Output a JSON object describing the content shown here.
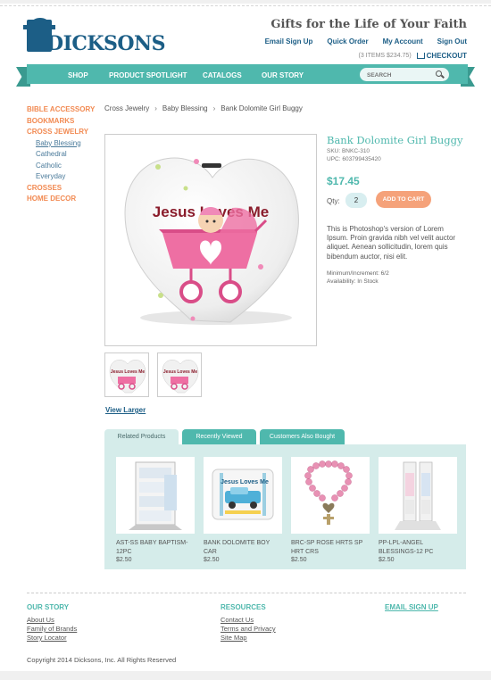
{
  "header": {
    "logo_text": "DICKSONS",
    "tagline": "Gifts for the Life of Your Faith",
    "links": [
      "Email Sign Up",
      "Quick Order",
      "My Account",
      "Sign Out"
    ],
    "cart_items": "(3 ITEMS $234.75)",
    "checkout_label": "CHECKOUT"
  },
  "nav": {
    "items": [
      "SHOP",
      "PRODUCT SPOTLIGHT",
      "CATALOGS",
      "OUR STORY"
    ],
    "search_placeholder": "SEARCH"
  },
  "sidebar": {
    "items": [
      {
        "label": "BIBLE ACCESSORY",
        "type": "category"
      },
      {
        "label": "BOOKMARKS",
        "type": "category"
      },
      {
        "label": "CROSS JEWELRY",
        "type": "category"
      },
      {
        "label": "Baby Blessing",
        "type": "sub",
        "active": true
      },
      {
        "label": "Cathedral",
        "type": "sub"
      },
      {
        "label": "Catholic",
        "type": "sub"
      },
      {
        "label": "Everyday",
        "type": "sub"
      },
      {
        "label": "CROSSES",
        "type": "category"
      },
      {
        "label": "HOME DECOR",
        "type": "category"
      }
    ]
  },
  "breadcrumb": [
    "Cross Jewelry",
    "Baby Blessing",
    "Bank Dolomite Girl Buggy"
  ],
  "product": {
    "title": "Bank Dolomite Girl Buggy",
    "sku": "SKU: BNKC-310",
    "upc": "UPC: 603799435420",
    "price": "$17.45",
    "qty_label": "Qty:",
    "qty_value": "2",
    "add_to_cart": "ADD TO CART",
    "description": "This is Photoshop's version  of Lorem Ipsum. Proin gravida nibh vel velit auctor aliquet. Aenean sollicitudin, lorem quis bibendum auctor, nisi elit.",
    "min_increment": "Minimum/Increment: 6/2",
    "availability": "Availability: In Stock",
    "image_text": "Jesus Loves Me",
    "thumb_text": "Jesus Loves Me",
    "view_larger": "View Larger"
  },
  "tabs": [
    "Related Products",
    "Recently Viewed",
    "Customers Also Bought"
  ],
  "related": [
    {
      "name": "AST-SS BABY BAPTISM-12PC",
      "price": "$2.50"
    },
    {
      "name": "BANK DOLOMITE BOY CAR",
      "price": "$2.50",
      "image_text": "Jesus Loves Me"
    },
    {
      "name": "BRC-SP ROSE HRTS SP HRT CRS",
      "price": "$2.50"
    },
    {
      "name": "PP-LPL-ANGEL BLESSINGS-12 PC",
      "price": "$2.50"
    }
  ],
  "footer": {
    "our_story_title": "OUR STORY",
    "our_story_links": [
      "About Us",
      "Family of Brands",
      "Story Locator"
    ],
    "resources_title": "RESOURCES",
    "resources_links": [
      "Contact Us",
      "Terms and Privacy",
      "Site Map"
    ],
    "email_signup": "EMAIL SIGN UP",
    "copyright": "Copyright 2014 Dicksons, Inc. All Rights Reserved"
  },
  "colors": {
    "teal": "#4fb8ad",
    "navy": "#1c5e86",
    "orange": "#f28a52",
    "light_teal": "#d5ecea"
  }
}
